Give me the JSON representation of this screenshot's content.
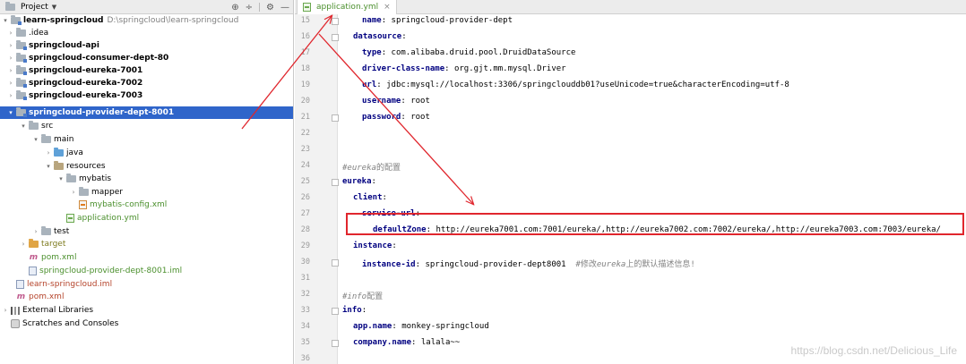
{
  "panel": {
    "title": "Project",
    "caret": "▼",
    "tools": [
      "⊕",
      "÷",
      "⚙",
      "—"
    ]
  },
  "tree": {
    "root": {
      "label": "learn-springcloud",
      "path": "D:\\springcloud\\learn-springcloud"
    },
    "idea": ".idea",
    "api": "springcloud-api",
    "consumer": "springcloud-consumer-dept-80",
    "eureka1": "springcloud-eureka-7001",
    "eureka2": "springcloud-eureka-7002",
    "eureka3": "springcloud-eureka-7003",
    "provider": "springcloud-provider-dept-8001",
    "src": "src",
    "main": "main",
    "java": "java",
    "resources": "resources",
    "mybatis": "mybatis",
    "mapper": "mapper",
    "mybatis_config": "mybatis-config.xml",
    "application": "application.yml",
    "test": "test",
    "target": "target",
    "pom_module": "pom.xml",
    "iml_module": "springcloud-provider-dept-8001.iml",
    "iml_root": "learn-springcloud.iml",
    "pom_root": "pom.xml",
    "external_libraries": "External Libraries",
    "scratches": "Scratches and Consoles"
  },
  "editor": {
    "tab_label": "application.yml",
    "tab_close": "×",
    "line_numbers": [
      "15",
      "16",
      "17",
      "18",
      "19",
      "20",
      "21",
      "22",
      "23",
      "24",
      "25",
      "26",
      "27",
      "28",
      "29",
      "30",
      "31",
      "32",
      "33",
      "34",
      "35",
      "36"
    ],
    "lines": {
      "l15": {
        "key": "name",
        "value": " springcloud-provider-dept"
      },
      "l16": {
        "key": "datasource"
      },
      "l17": {
        "key": "type",
        "value": " com.alibaba.druid.pool.DruidDataSource"
      },
      "l18": {
        "key": "driver-class-name",
        "value": " org.gjt.mm.mysql.Driver"
      },
      "l19": {
        "key": "url",
        "value": " jdbc:mysql://localhost:3306/springclouddb01?useUnicode=true&characterEncoding=utf-8"
      },
      "l20": {
        "key": "username",
        "value": " root"
      },
      "l21": {
        "key": "password",
        "value": " root"
      },
      "l24": {
        "comment": "#eureka",
        "comment_cn": "的配置"
      },
      "l25": {
        "key": "eureka"
      },
      "l26": {
        "key": "client"
      },
      "l27": {
        "key": "service-url"
      },
      "l28": {
        "key": "defaultZone",
        "value": " http://eureka7001.com:7001/eureka/,http://eureka7002.com:7002/eureka/,http://eureka7003.com:7003/eureka/"
      },
      "l29": {
        "key": "instance"
      },
      "l30": {
        "key": "instance-id",
        "value": " springcloud-provider-dept8001  ",
        "comment": "#修改",
        "comment_em": "eureka",
        "comment_tail": "上的默认描述信息!"
      },
      "l32": {
        "comment": "#info",
        "comment_cn": "配置"
      },
      "l33": {
        "key": "info"
      },
      "l34": {
        "key": "app.name",
        "value": " monkey-springcloud"
      },
      "l35": {
        "key": "company.name",
        "value": " lalala~~"
      }
    }
  },
  "watermark": "https://blog.csdn.net/Delicious_Life",
  "colors": {
    "selection": "#2f65ca",
    "yaml_key": "#000080",
    "annotation_red": "#e0262d"
  }
}
